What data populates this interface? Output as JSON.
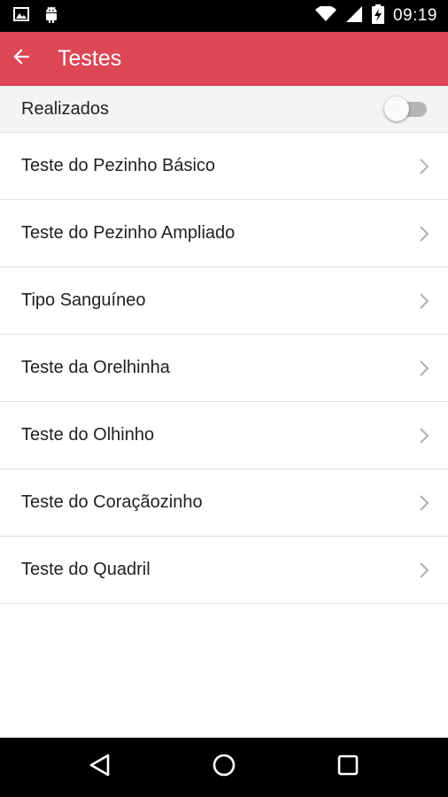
{
  "status_bar": {
    "time": "09:19",
    "icons": [
      "image-icon",
      "android-icon",
      "wifi-icon",
      "signal-icon",
      "battery-charging-icon"
    ]
  },
  "app_bar": {
    "title": "Testes",
    "back_icon": "arrow-back-icon",
    "background_color": "#dc4655"
  },
  "filter": {
    "label": "Realizados",
    "toggle_on": false
  },
  "tests": [
    {
      "label": "Teste do Pezinho Básico"
    },
    {
      "label": "Teste do Pezinho Ampliado"
    },
    {
      "label": "Tipo Sanguíneo"
    },
    {
      "label": "Teste da Orelhinha"
    },
    {
      "label": "Teste do Olhinho"
    },
    {
      "label": "Teste do Coraçãozinho"
    },
    {
      "label": "Teste do Quadril"
    }
  ],
  "nav_bar": {
    "icons": [
      "back-triangle-icon",
      "home-circle-icon",
      "recents-square-icon"
    ]
  }
}
